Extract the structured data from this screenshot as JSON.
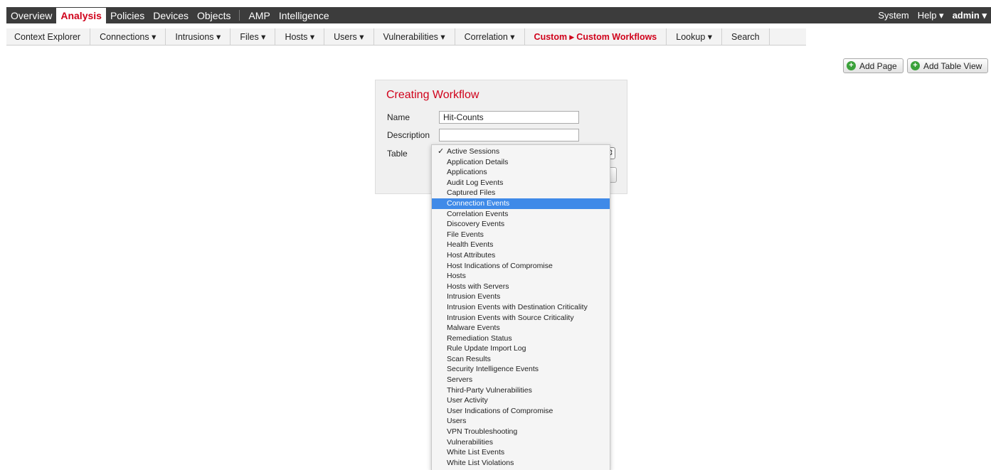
{
  "topnav": {
    "items": [
      "Overview",
      "Analysis",
      "Policies",
      "Devices",
      "Objects",
      "AMP",
      "Intelligence"
    ],
    "active": "Analysis",
    "right": {
      "system": "System",
      "help": "Help ▾",
      "admin": "admin ▾"
    }
  },
  "subnav": {
    "items": [
      "Context Explorer",
      "Connections ▾",
      "Intrusions ▾",
      "Files ▾",
      "Hosts ▾",
      "Users ▾",
      "Vulnerabilities ▾",
      "Correlation ▾",
      "Custom ▸ Custom Workflows",
      "Lookup ▾",
      "Search"
    ],
    "current": "Custom ▸ Custom Workflows"
  },
  "actions": {
    "add_page": "Add Page",
    "add_table_view": "Add Table View"
  },
  "form": {
    "title": "Creating Workflow",
    "name_label": "Name",
    "name_value": "Hit-Counts",
    "description_label": "Description",
    "description_value": "",
    "table_label": "Table"
  },
  "dropdown": {
    "selected": "Active Sessions",
    "highlighted": "Connection Events",
    "options": [
      "Active Sessions",
      "Application Details",
      "Applications",
      "Audit Log Events",
      "Captured Files",
      "Connection Events",
      "Correlation Events",
      "Discovery Events",
      "File Events",
      "Health Events",
      "Host Attributes",
      "Host Indications of Compromise",
      "Hosts",
      "Hosts with Servers",
      "Intrusion Events",
      "Intrusion Events with Destination Criticality",
      "Intrusion Events with Source Criticality",
      "Malware Events",
      "Remediation Status",
      "Rule Update Import Log",
      "Scan Results",
      "Security Intelligence Events",
      "Servers",
      "Third-Party Vulnerabilities",
      "User Activity",
      "User Indications of Compromise",
      "Users",
      "VPN Troubleshooting",
      "Vulnerabilities",
      "White List Events",
      "White List Violations"
    ]
  },
  "colors": {
    "brand_red": "#d0021b",
    "topbar_bg": "#3c3c3c",
    "highlight": "#3f8ae8",
    "add_green": "#3aa13a"
  }
}
